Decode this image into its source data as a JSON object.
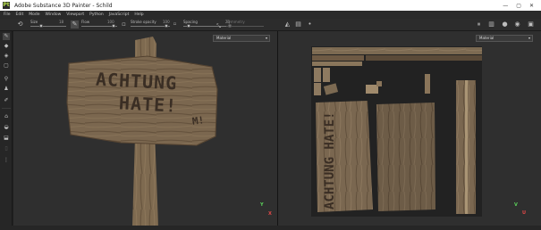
{
  "window": {
    "title": "Adobe Substance 3D Painter - Schild",
    "app_icon": "Pt",
    "controls": [
      "—",
      "▢",
      "✕"
    ]
  },
  "menu": [
    "File",
    "Edit",
    "Mode",
    "Window",
    "Viewport",
    "Python",
    "JavaScript",
    "Help"
  ],
  "toolbar": {
    "size": {
      "label": "Size",
      "value": "18"
    },
    "flow": {
      "label": "Flow",
      "value": "100"
    },
    "stroke_opacity": {
      "label": "Stroke opacity",
      "value": "100"
    },
    "spacing": {
      "label": "Spacing",
      "value": "20"
    },
    "symmetry_label": "Symmetry"
  },
  "viewport_3d": {
    "channel": "Material",
    "sign_text_line1": "ACHTUNG",
    "sign_text_line2": "HATE!",
    "sign_small": "M!",
    "axis_y": "Y",
    "axis_x": "X"
  },
  "viewport_2d": {
    "channel": "Material",
    "uv_text": "ACHTUNG HATE!",
    "axis_v": "V",
    "axis_u": "U"
  },
  "colors": {
    "accent_y": "#5bd15b",
    "accent_x": "#e04848",
    "accent_u": "#e04848",
    "accent_v": "#5bd15b"
  }
}
